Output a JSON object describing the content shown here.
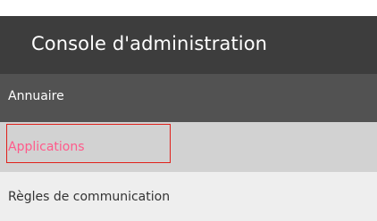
{
  "header": {
    "title": "Console d'administration"
  },
  "menu": {
    "items": [
      {
        "label": "Annuaire",
        "state": "default"
      },
      {
        "label": "Applications",
        "state": "selected"
      },
      {
        "label": "Règles de communication",
        "state": "default"
      }
    ]
  },
  "colors": {
    "header_bg": "#3d3d3d",
    "item_annuaire_bg": "#525252",
    "item_selected_bg": "#d2d2d2",
    "item_selected_text": "#ff5a8a",
    "item_default_bg": "#eeeeee",
    "highlight_border": "#e0201a"
  }
}
